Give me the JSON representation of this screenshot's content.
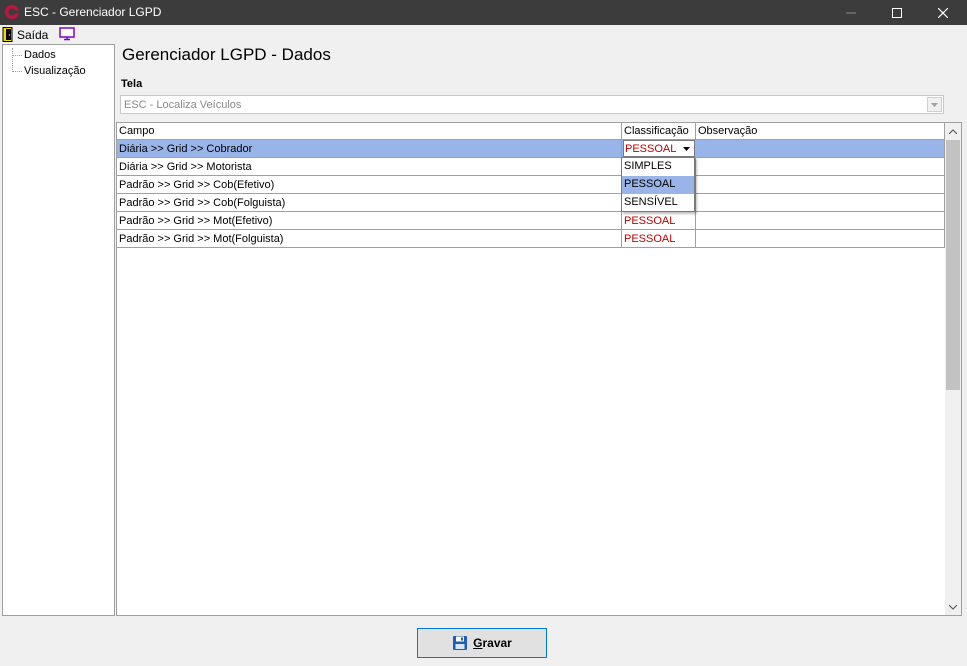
{
  "window": {
    "title": "ESC - Gerenciador LGPD",
    "minimize_glyph": "—",
    "maximize_glyph": "☐",
    "close_glyph": "✕"
  },
  "toolbar": {
    "exit_label": "Saída",
    "exit_icon": "door-exit-icon",
    "monitor_icon": "monitor-icon"
  },
  "tree": {
    "items": [
      {
        "label": "Dados"
      },
      {
        "label": "Visualização"
      }
    ]
  },
  "main": {
    "title": "Gerenciador LGPD - Dados",
    "tela_label": "Tela",
    "tela_value": "ESC - Localiza Veículos"
  },
  "grid": {
    "columns": [
      "Campo",
      "Classificação",
      "Observação"
    ],
    "rows": [
      {
        "campo": "Diária >> Grid >> Cobrador",
        "classificacao": "PESSOAL",
        "observacao": ""
      },
      {
        "campo": "Diária >> Grid >> Motorista",
        "classificacao": "",
        "observacao": ""
      },
      {
        "campo": "Padrão >> Grid >> Cob(Efetivo)",
        "classificacao": "",
        "observacao": ""
      },
      {
        "campo": "Padrão >> Grid >> Cob(Folguista)",
        "classificacao": "",
        "observacao": ""
      },
      {
        "campo": "Padrão >> Grid >> Mot(Efetivo)",
        "classificacao": "PESSOAL",
        "observacao": ""
      },
      {
        "campo": "Padrão >> Grid >> Mot(Folguista)",
        "classificacao": "PESSOAL",
        "observacao": ""
      }
    ],
    "selected_row": 0,
    "dropdown_options": [
      "SIMPLES",
      "PESSOAL",
      "SENSÍVEL"
    ],
    "dropdown_highlighted": "PESSOAL"
  },
  "footer": {
    "save_label_first": "G",
    "save_label_rest": "ravar"
  },
  "colors": {
    "titlebar": "#3c3c3c",
    "selection": "#99b4e8",
    "pessoal_text": "#c00000",
    "button_border": "#0078d7"
  }
}
